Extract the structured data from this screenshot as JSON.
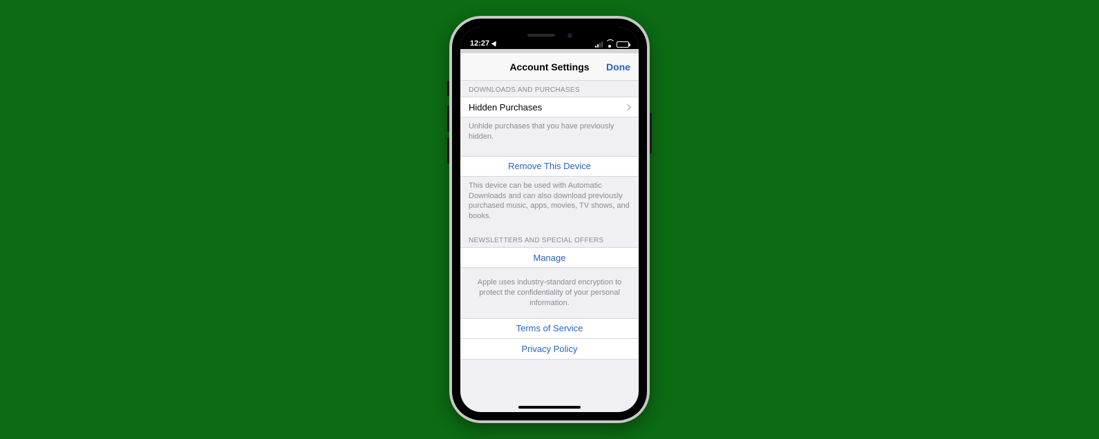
{
  "status": {
    "time": "12:27"
  },
  "nav": {
    "title": "Account Settings",
    "done": "Done"
  },
  "downloads": {
    "header": "DOWNLOADS AND PURCHASES",
    "hidden_row": "Hidden Purchases",
    "hidden_footer": "Unhide purchases that you have previously hidden.",
    "remove_device": "Remove This Device",
    "remove_footer": "This device can be used with Automatic Downloads and can also download previously purchased music, apps, movies, TV shows, and books."
  },
  "newsletters": {
    "header": "NEWSLETTERS AND SPECIAL OFFERS",
    "manage": "Manage"
  },
  "legal": {
    "encryption": "Apple uses industry-standard encryption to protect the confidentiality of your personal information.",
    "terms": "Terms of Service",
    "privacy": "Privacy Policy"
  }
}
